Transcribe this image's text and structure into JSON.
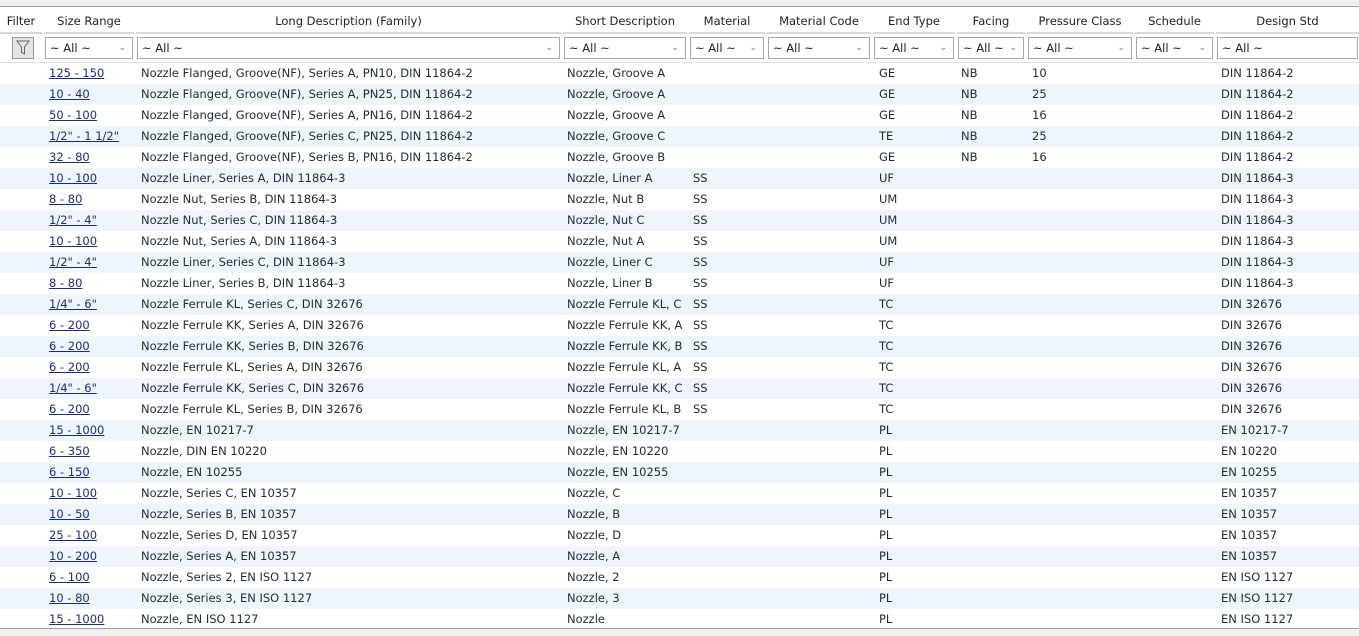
{
  "columns": [
    "Filter",
    "Size Range",
    "Long Description (Family)",
    "Short Description",
    "Material",
    "Material Code",
    "End Type",
    "Facing",
    "Pressure Class",
    "Schedule",
    "Design Std"
  ],
  "filter_value": "~ All ~",
  "rows": [
    [
      "125 - 150",
      "Nozzle Flanged, Groove(NF), Series A, PN10, DIN 11864-2",
      "Nozzle, Groove A",
      "",
      "",
      "GE",
      "NB",
      "10",
      "",
      "DIN 11864-2"
    ],
    [
      "10 - 40",
      "Nozzle Flanged, Groove(NF), Series A, PN25, DIN 11864-2",
      "Nozzle, Groove A",
      "",
      "",
      "GE",
      "NB",
      "25",
      "",
      "DIN 11864-2"
    ],
    [
      "50 - 100",
      "Nozzle Flanged, Groove(NF), Series A, PN16, DIN 11864-2",
      "Nozzle, Groove A",
      "",
      "",
      "GE",
      "NB",
      "16",
      "",
      "DIN 11864-2"
    ],
    [
      "1/2\" - 1 1/2\"",
      "Nozzle Flanged, Groove(NF), Series C, PN25, DIN 11864-2",
      "Nozzle, Groove C",
      "",
      "",
      "TE",
      "NB",
      "25",
      "",
      "DIN 11864-2"
    ],
    [
      "32 - 80",
      "Nozzle Flanged, Groove(NF), Series B, PN16, DIN 11864-2",
      "Nozzle, Groove B",
      "",
      "",
      "GE",
      "NB",
      "16",
      "",
      "DIN 11864-2"
    ],
    [
      "10 - 100",
      "Nozzle Liner, Series A, DIN 11864-3",
      "Nozzle, Liner A",
      "SS",
      "",
      "UF",
      "",
      "",
      "",
      "DIN 11864-3"
    ],
    [
      "8 - 80",
      "Nozzle Nut, Series B, DIN 11864-3",
      "Nozzle, Nut B",
      "SS",
      "",
      "UM",
      "",
      "",
      "",
      "DIN 11864-3"
    ],
    [
      "1/2\" - 4\"",
      "Nozzle Nut, Series C, DIN 11864-3",
      "Nozzle, Nut C",
      "SS",
      "",
      "UM",
      "",
      "",
      "",
      "DIN 11864-3"
    ],
    [
      "10 - 100",
      "Nozzle Nut, Series A, DIN 11864-3",
      "Nozzle, Nut A",
      "SS",
      "",
      "UM",
      "",
      "",
      "",
      "DIN 11864-3"
    ],
    [
      "1/2\" - 4\"",
      "Nozzle Liner, Series C, DIN 11864-3",
      "Nozzle, Liner C",
      "SS",
      "",
      "UF",
      "",
      "",
      "",
      "DIN 11864-3"
    ],
    [
      "8 - 80",
      "Nozzle Liner, Series B, DIN 11864-3",
      "Nozzle, Liner B",
      "SS",
      "",
      "UF",
      "",
      "",
      "",
      "DIN 11864-3"
    ],
    [
      "1/4\" - 6\"",
      "Nozzle Ferrule KL, Series C, DIN 32676",
      "Nozzle Ferrule KL, C",
      "SS",
      "",
      "TC",
      "",
      "",
      "",
      "DIN 32676"
    ],
    [
      "6 - 200",
      "Nozzle Ferrule KK, Series A, DIN 32676",
      "Nozzle Ferrule KK, A",
      "SS",
      "",
      "TC",
      "",
      "",
      "",
      "DIN 32676"
    ],
    [
      "6 - 200",
      "Nozzle Ferrule KK, Series B, DIN 32676",
      "Nozzle Ferrule KK, B",
      "SS",
      "",
      "TC",
      "",
      "",
      "",
      "DIN 32676"
    ],
    [
      "6 - 200",
      "Nozzle Ferrule KL, Series A, DIN 32676",
      "Nozzle Ferrule KL, A",
      "SS",
      "",
      "TC",
      "",
      "",
      "",
      "DIN 32676"
    ],
    [
      "1/4\" - 6\"",
      "Nozzle Ferrule KK, Series C, DIN 32676",
      "Nozzle Ferrule KK, C",
      "SS",
      "",
      "TC",
      "",
      "",
      "",
      "DIN 32676"
    ],
    [
      "6 - 200",
      "Nozzle Ferrule KL, Series B, DIN 32676",
      "Nozzle Ferrule KL, B",
      "SS",
      "",
      "TC",
      "",
      "",
      "",
      "DIN 32676"
    ],
    [
      "15 - 1000",
      "Nozzle, EN 10217-7",
      "Nozzle, EN 10217-7",
      "",
      "",
      "PL",
      "",
      "",
      "",
      "EN 10217-7"
    ],
    [
      "6 - 350",
      "Nozzle, DIN EN 10220",
      "Nozzle, EN 10220",
      "",
      "",
      "PL",
      "",
      "",
      "",
      "EN 10220"
    ],
    [
      "6 - 150",
      "Nozzle, EN 10255",
      "Nozzle, EN 10255",
      "",
      "",
      "PL",
      "",
      "",
      "",
      "EN 10255"
    ],
    [
      "10 - 100",
      "Nozzle, Series C, EN 10357",
      "Nozzle, C",
      "",
      "",
      "PL",
      "",
      "",
      "",
      "EN 10357"
    ],
    [
      "10 - 50",
      "Nozzle, Series B, EN 10357",
      "Nozzle, B",
      "",
      "",
      "PL",
      "",
      "",
      "",
      "EN 10357"
    ],
    [
      "25 - 100",
      "Nozzle, Series D, EN 10357",
      "Nozzle, D",
      "",
      "",
      "PL",
      "",
      "",
      "",
      "EN 10357"
    ],
    [
      "10 - 200",
      "Nozzle, Series A, EN 10357",
      "Nozzle, A",
      "",
      "",
      "PL",
      "",
      "",
      "",
      "EN 10357"
    ],
    [
      "6 - 100",
      "Nozzle, Series 2, EN ISO 1127",
      "Nozzle, 2",
      "",
      "",
      "PL",
      "",
      "",
      "",
      "EN ISO 1127"
    ],
    [
      "10 - 80",
      "Nozzle, Series 3, EN ISO 1127",
      "Nozzle, 3",
      "",
      "",
      "PL",
      "",
      "",
      "",
      "EN ISO 1127"
    ],
    [
      "15 - 1000",
      "Nozzle, EN ISO 1127",
      "Nozzle",
      "",
      "",
      "PL",
      "",
      "",
      "",
      "EN ISO 1127"
    ]
  ]
}
